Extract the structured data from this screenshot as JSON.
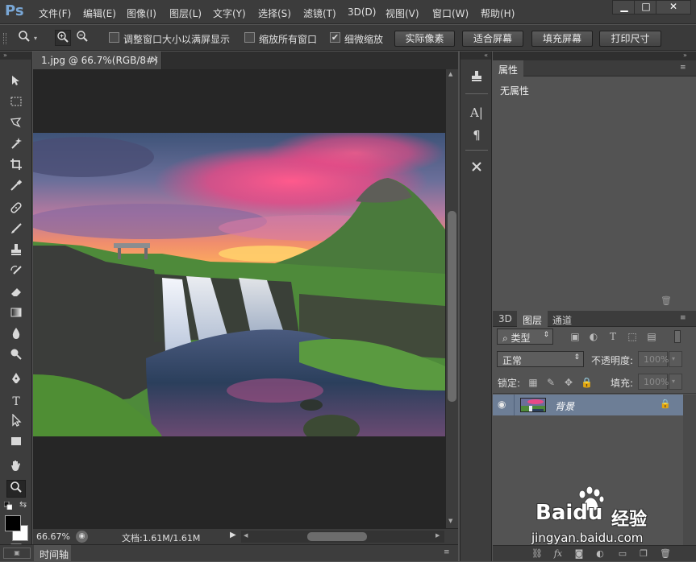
{
  "app": {
    "logo": "Ps"
  },
  "menu": [
    "文件(F)",
    "编辑(E)",
    "图像(I)",
    "图层(L)",
    "文字(Y)",
    "选择(S)",
    "滤镜(T)",
    "3D(D)",
    "视图(V)",
    "窗口(W)",
    "帮助(H)"
  ],
  "window_controls": {
    "minimize": "▁",
    "maximize": "□",
    "close": "✕"
  },
  "options_bar": {
    "check_resize_window": "调整窗口大小以满屏显示",
    "check_zoom_all": "缩放所有窗口",
    "check_scrubby": "细微缩放",
    "scrubby_checked": "✔",
    "btn_actual_pixels": "实际像素",
    "btn_fit_screen": "适合屏幕",
    "btn_fill_screen": "填充屏幕",
    "btn_print_size": "打印尺寸"
  },
  "document": {
    "tab_title": "1.jpg @ 66.7%(RGB/8#)",
    "tab_close": "×",
    "zoom": "66.67%",
    "doc_size": "文档:1.61M/1.61M"
  },
  "timeline": {
    "label": "时间轴"
  },
  "properties": {
    "tab": "属性",
    "content": "无属性"
  },
  "layers": {
    "tabs": [
      "3D",
      "图层",
      "通道"
    ],
    "filter_kind": "类型",
    "blend_mode": "正常",
    "opacity_label": "不透明度:",
    "opacity_value": "100%",
    "lock_label": "锁定:",
    "fill_label": "填充:",
    "fill_value": "100%",
    "layer_name": "背景"
  },
  "watermark": {
    "brand": "Baidu",
    "suffix": "经验",
    "url": "jingyan.baidu.com"
  },
  "colors": {
    "accent_logo": "#79a7d6",
    "selected_layer": "#6d7e96",
    "canvas_bg": "#262626"
  }
}
